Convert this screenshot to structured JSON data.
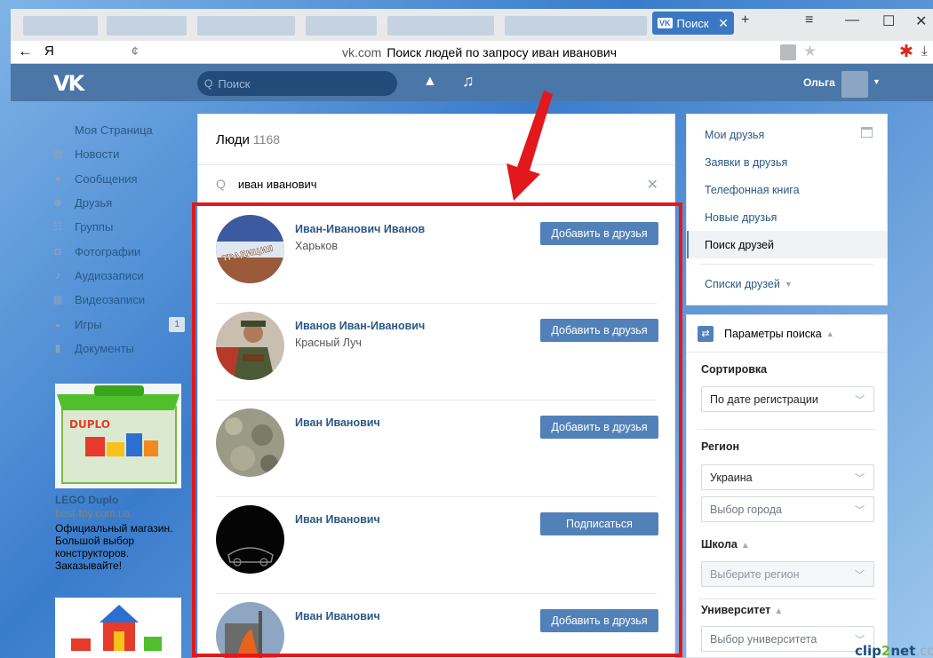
{
  "browser": {
    "tab_title": "Поиск",
    "tab_icon_text": "VK",
    "back_glyph": "←",
    "yandex_glyph": "Я",
    "url_domain": "vk.com",
    "url_title": "Поиск людей по запросу иван иванович"
  },
  "header": {
    "logo": "VK",
    "search_placeholder": "Поиск",
    "username": "Ольга"
  },
  "left_nav": [
    {
      "label": "Моя Страница",
      "icon": "home-icon"
    },
    {
      "label": "Новости",
      "icon": "news-icon"
    },
    {
      "label": "Сообщения",
      "icon": "messages-icon"
    },
    {
      "label": "Друзья",
      "icon": "friends-icon"
    },
    {
      "label": "Группы",
      "icon": "groups-icon"
    },
    {
      "label": "Фотографии",
      "icon": "camera-icon"
    },
    {
      "label": "Аудиозаписи",
      "icon": "music-note-icon"
    },
    {
      "label": "Видеозаписи",
      "icon": "film-icon"
    },
    {
      "label": "Игры",
      "icon": "gamepad-icon",
      "badge": "1"
    },
    {
      "label": "Документы",
      "icon": "document-icon"
    }
  ],
  "ad": {
    "title": "LEGO Duplo",
    "domain": "best-toy.com.ua",
    "text": "Официальный магазин. Большой выбор конструкторов. Заказывайте!",
    "image_text": "DUPLO"
  },
  "people": {
    "title": "Люди",
    "count": "1168",
    "query": "иван иванович",
    "results": [
      {
        "name": "Иван-Иванович Иванов",
        "city": "Харьков",
        "action": "Добавить в друзья",
        "avatar_text": "ТРАДИЦИЯ"
      },
      {
        "name": "Иванов Иван-Иванович",
        "city": "Красный Луч",
        "action": "Добавить в друзья"
      },
      {
        "name": "Иван Иванович",
        "city": "",
        "action": "Добавить в друзья"
      },
      {
        "name": "Иван Иванович",
        "city": "",
        "action": "Подписаться"
      },
      {
        "name": "Иван Иванович",
        "city": "",
        "action": "Добавить в друзья"
      }
    ]
  },
  "right_nav": {
    "items": [
      "Мои друзья",
      "Заявки в друзья",
      "Телефонная книга",
      "Новые друзья",
      "Поиск друзей"
    ],
    "active_index": 4,
    "lists_label": "Списки друзей"
  },
  "search_params": {
    "title": "Параметры поиска",
    "sort_label": "Сортировка",
    "sort_value": "По дате регистрации",
    "region_label": "Регион",
    "country_value": "Украина",
    "city_placeholder": "Выбор города",
    "school_label": "Школа",
    "school_placeholder": "Выберите регион",
    "university_label": "Университет",
    "university_placeholder": "Выбор университета"
  },
  "watermark": {
    "part1": "clip",
    "part2": "2",
    "part3": "net",
    "part4": ".com"
  },
  "colors": {
    "vk_blue": "#4a76a8",
    "button_blue": "#5181b8",
    "link": "#2a5885",
    "highlight_red": "#e2181c"
  }
}
